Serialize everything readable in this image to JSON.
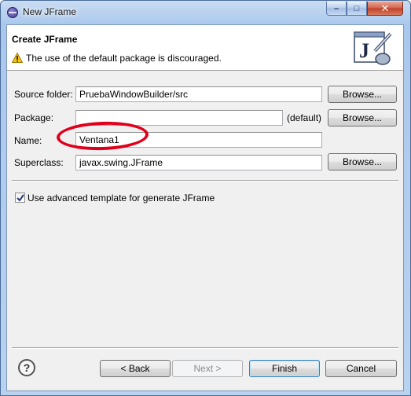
{
  "window": {
    "title": "New JFrame",
    "controls": {
      "minimize": "–",
      "maximize": "□",
      "close": "✕"
    }
  },
  "banner": {
    "title": "Create JFrame",
    "message": "The use of the default package is discouraged.",
    "icon": "jframe-wizard-icon"
  },
  "form": {
    "source_folder": {
      "label": "Source folder:",
      "value": "PruebaWindowBuilder/src",
      "button": "Browse..."
    },
    "package": {
      "label": "Package:",
      "value": "",
      "suffix": "(default)",
      "button": "Browse..."
    },
    "name": {
      "label": "Name:",
      "value": "Ventana1"
    },
    "superclass": {
      "label": "Superclass:",
      "value": "javax.swing.JFrame",
      "button": "Browse..."
    },
    "advanced_template": {
      "label": "Use advanced template for generate JFrame",
      "checked": true
    }
  },
  "footer": {
    "help": "?",
    "back": "< Back",
    "next": "Next >",
    "finish": "Finish",
    "cancel": "Cancel"
  },
  "colors": {
    "annotation": "#e0001b",
    "warning": "#f2c21a"
  }
}
